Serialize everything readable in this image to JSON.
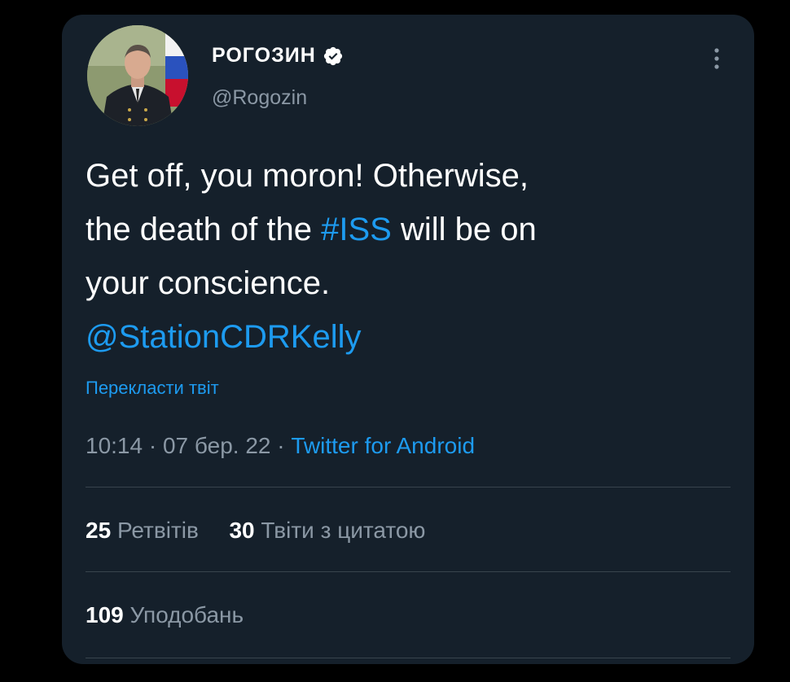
{
  "author": {
    "display_name": "РОГОЗИН",
    "handle": "@Rogozin",
    "verified": true
  },
  "tweet": {
    "text_part1": "Get off, you moron!  Otherwise,",
    "text_part2": "the death of the ",
    "hashtag": "#ISS",
    "text_part3": " will be on",
    "text_part4": "your conscience.",
    "mention": "@StationCDRKelly"
  },
  "translate_label": "Перекласти твіт",
  "meta": {
    "time": "10:14",
    "separator": " · ",
    "date": "07 бер. 22",
    "source": "Twitter for Android"
  },
  "stats": {
    "retweets_count": "25",
    "retweets_label": "Ретвітів",
    "quotes_count": "30",
    "quotes_label": "Твіти з цитатою",
    "likes_count": "109",
    "likes_label": "Уподобань"
  },
  "colors": {
    "background": "#000000",
    "card": "#15202b",
    "accent": "#1d9bf0",
    "muted": "#8b98a5",
    "divider": "#38444d"
  },
  "icons": [
    "verified-badge-icon",
    "more-options-icon"
  ]
}
